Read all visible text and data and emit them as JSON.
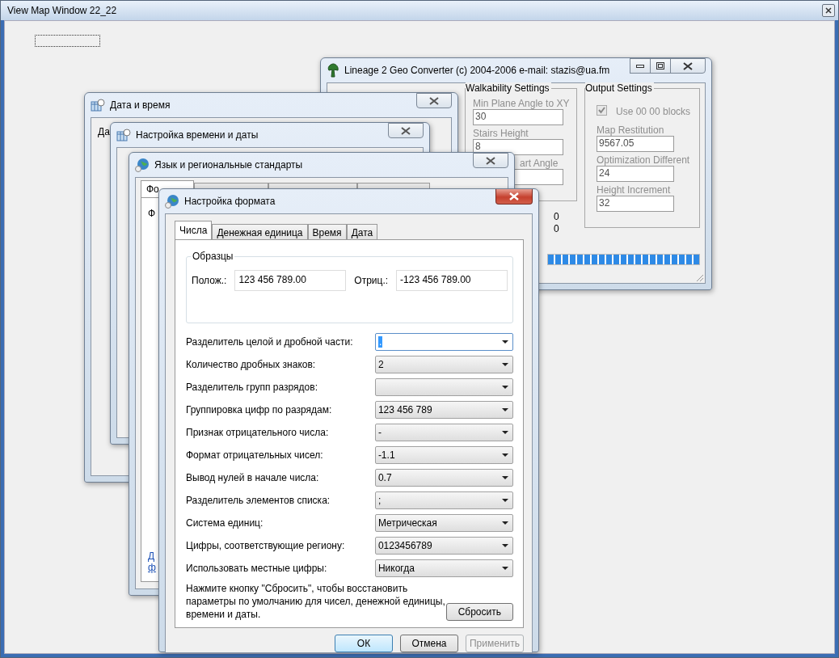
{
  "main_window": {
    "title": "View Map Window 22_22"
  },
  "converter_window": {
    "title": "Lineage 2 Geo Converter (c) 2004-2006 e-mail: stazis@ua.fm",
    "walkability": {
      "title": "Walkability Settings",
      "fields": [
        {
          "label": "Min Plane Angle to XY",
          "value": "30",
          "kind": "full"
        },
        {
          "label": "Stairs Height",
          "value": "8",
          "kind": "full"
        },
        {
          "label": "art Angle",
          "kind": "clipped"
        }
      ]
    },
    "output": {
      "title": "Output Settings",
      "checkbox": {
        "label": "Use 00 00 blocks",
        "checked": true,
        "disabled": true
      },
      "fields": [
        {
          "label": "Map Restitution",
          "value": "9567.05"
        },
        {
          "label": "Optimization Different",
          "value": "24"
        },
        {
          "label": "Height Increment",
          "value": "32"
        }
      ]
    },
    "counters": [
      "0",
      "0"
    ],
    "progress": {
      "level": 1
    }
  },
  "date_window": {
    "title": "Дата и время",
    "fragment": "Да"
  },
  "time_window": {
    "title": "Настройка времени и даты"
  },
  "language_window": {
    "title": "Язык и региональные стандарты",
    "tab": {
      "label": "Фо",
      "selected": true
    },
    "fragments": [
      {
        "text": "Ф",
        "kind": "label"
      },
      {
        "text": "Д",
        "kind": "link"
      },
      {
        "text": "ф",
        "kind": "link"
      }
    ]
  },
  "format_dialog": {
    "title": "Настройка формата",
    "tabs": [
      {
        "label": "Числа",
        "selected": true
      },
      {
        "label": "Денежная единица",
        "selected": false
      },
      {
        "label": "Время",
        "selected": false
      },
      {
        "label": "Дата",
        "selected": false
      }
    ],
    "samples": {
      "title": "Образцы",
      "positive_label": "Полож.:",
      "positive": "123 456 789.00",
      "negative_label": "Отриц.:",
      "negative": "-123 456 789.00"
    },
    "settings": [
      {
        "label": "Разделитель целой и дробной части:",
        "value": ".",
        "focused": true
      },
      {
        "label": "Количество дробных знаков:",
        "value": "2",
        "focused": false
      },
      {
        "label": "Разделитель групп разрядов:",
        "focused": false
      },
      {
        "label": "Группировка цифр по разрядам:",
        "value": "123 456 789",
        "focused": false
      },
      {
        "label": "Признак отрицательного числа:",
        "value": "-",
        "focused": false
      },
      {
        "label": "Формат отрицательных чисел:",
        "value": "-1.1",
        "focused": false
      },
      {
        "label": "Вывод нулей в начале числа:",
        "value": "0.7",
        "focused": false
      },
      {
        "label": "Разделитель элементов списка:",
        "value": ";",
        "focused": false
      },
      {
        "label": "Система единиц:",
        "value": "Метрическая",
        "focused": false
      },
      {
        "label": "Цифры, соответствующие региону:",
        "value": "0123456789",
        "focused": false
      },
      {
        "label": "Использовать местные цифры:",
        "value": "Никогда",
        "focused": false
      }
    ],
    "note": "Нажмите кнопку \"Сбросить\", чтобы восстановить параметры по умолчанию для чисел, денежной единицы, времени и даты.",
    "reset_button": "Сбросить",
    "buttons": [
      {
        "label": "ОК",
        "kind": "default",
        "disabled": false
      },
      {
        "label": "Отмена",
        "kind": "normal",
        "disabled": false
      },
      {
        "label": "Применить",
        "kind": "normal",
        "disabled": true
      }
    ]
  }
}
